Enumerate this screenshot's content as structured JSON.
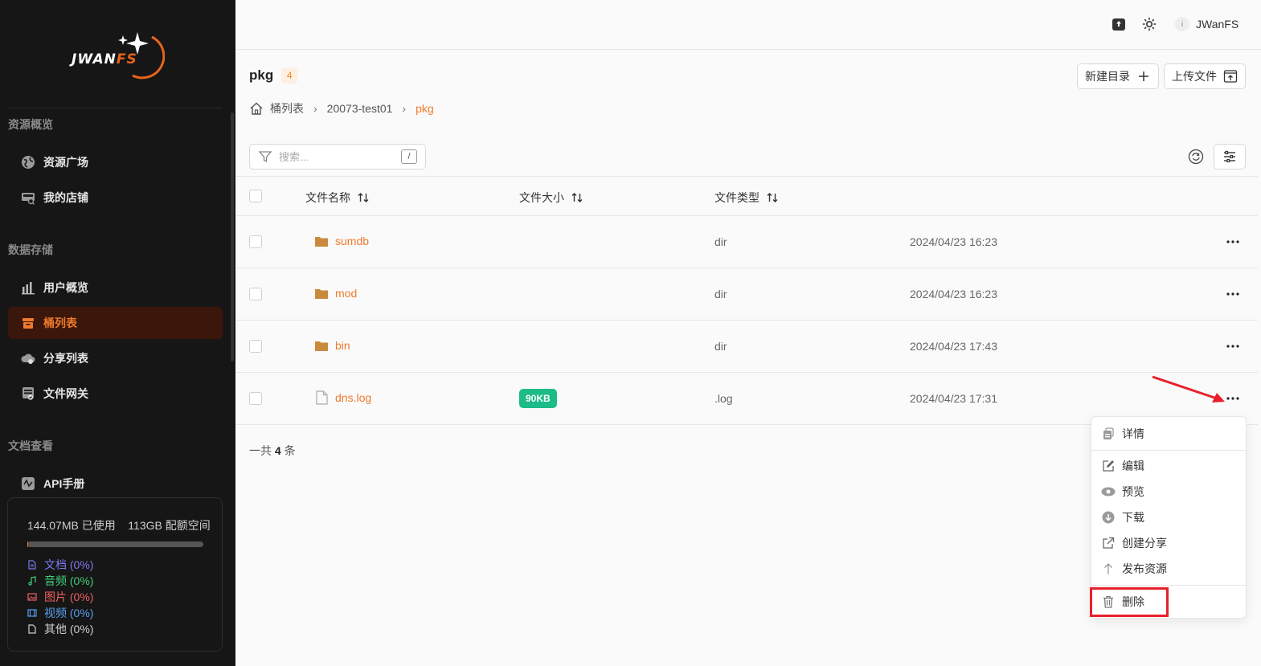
{
  "app": {
    "logo_text_a": "JWAN",
    "logo_text_b": "FS"
  },
  "sidebar": {
    "sections": [
      {
        "title": "资源概览",
        "items": [
          {
            "label": "资源广场",
            "icon": "globe-icon"
          },
          {
            "label": "我的店铺",
            "icon": "store-icon"
          }
        ]
      },
      {
        "title": "数据存储",
        "items": [
          {
            "label": "用户概览",
            "icon": "bar-chart-icon"
          },
          {
            "label": "桶列表",
            "icon": "bucket-icon",
            "active": true
          },
          {
            "label": "分享列表",
            "icon": "share-cloud-icon"
          },
          {
            "label": "文件网关",
            "icon": "gateway-icon"
          }
        ]
      },
      {
        "title": "文档查看",
        "items": [
          {
            "label": "API手册",
            "icon": "api-icon"
          }
        ]
      }
    ],
    "storage": {
      "used": "144.07MB 已使用",
      "quota": "113GB 配额空间",
      "used_fraction": 0.0013,
      "legend": [
        {
          "label": "文档 (0%)",
          "color": "#7b7bf0",
          "icon": "document-icon"
        },
        {
          "label": "音频 (0%)",
          "color": "#3fd07a",
          "icon": "music-icon"
        },
        {
          "label": "图片 (0%)",
          "color": "#f06060",
          "icon": "image-icon"
        },
        {
          "label": "视频 (0%)",
          "color": "#5aa0f0",
          "icon": "video-icon"
        },
        {
          "label": "其他 (0%)",
          "color": "#cfcfcf",
          "icon": "file-icon"
        }
      ]
    }
  },
  "topbar": {
    "avatar_letter": "i",
    "username": "JWanFS"
  },
  "page": {
    "title": "pkg",
    "count": "4",
    "new_dir_label": "新建目录",
    "upload_label": "上传文件",
    "breadcrumb": [
      "桶列表",
      "20073-test01",
      "pkg"
    ],
    "search_placeholder": "搜索...",
    "search_shortcut": "/",
    "columns": {
      "name": "文件名称",
      "size": "文件大小",
      "type": "文件类型"
    },
    "rows": [
      {
        "name": "sumdb",
        "kind": "folder",
        "size": "",
        "type": "dir",
        "date": "2024/04/23 16:23"
      },
      {
        "name": "mod",
        "kind": "folder",
        "size": "",
        "type": "dir",
        "date": "2024/04/23 16:23"
      },
      {
        "name": "bin",
        "kind": "folder",
        "size": "",
        "type": "dir",
        "date": "2024/04/23 17:43"
      },
      {
        "name": "dns.log",
        "kind": "file",
        "size": "90KB",
        "type": ".log",
        "date": "2024/04/23 17:31"
      }
    ],
    "total_prefix": "一共",
    "total_count": "4",
    "total_suffix": "条"
  },
  "context_menu": {
    "items": [
      "详情",
      "编辑",
      "预览",
      "下载",
      "创建分享",
      "发布资源",
      "删除"
    ]
  },
  "colors": {
    "accent": "#f07a2c",
    "sidebar_bg": "#161616",
    "size_badge": "#1dbb87",
    "annotation": "#e8202a"
  }
}
